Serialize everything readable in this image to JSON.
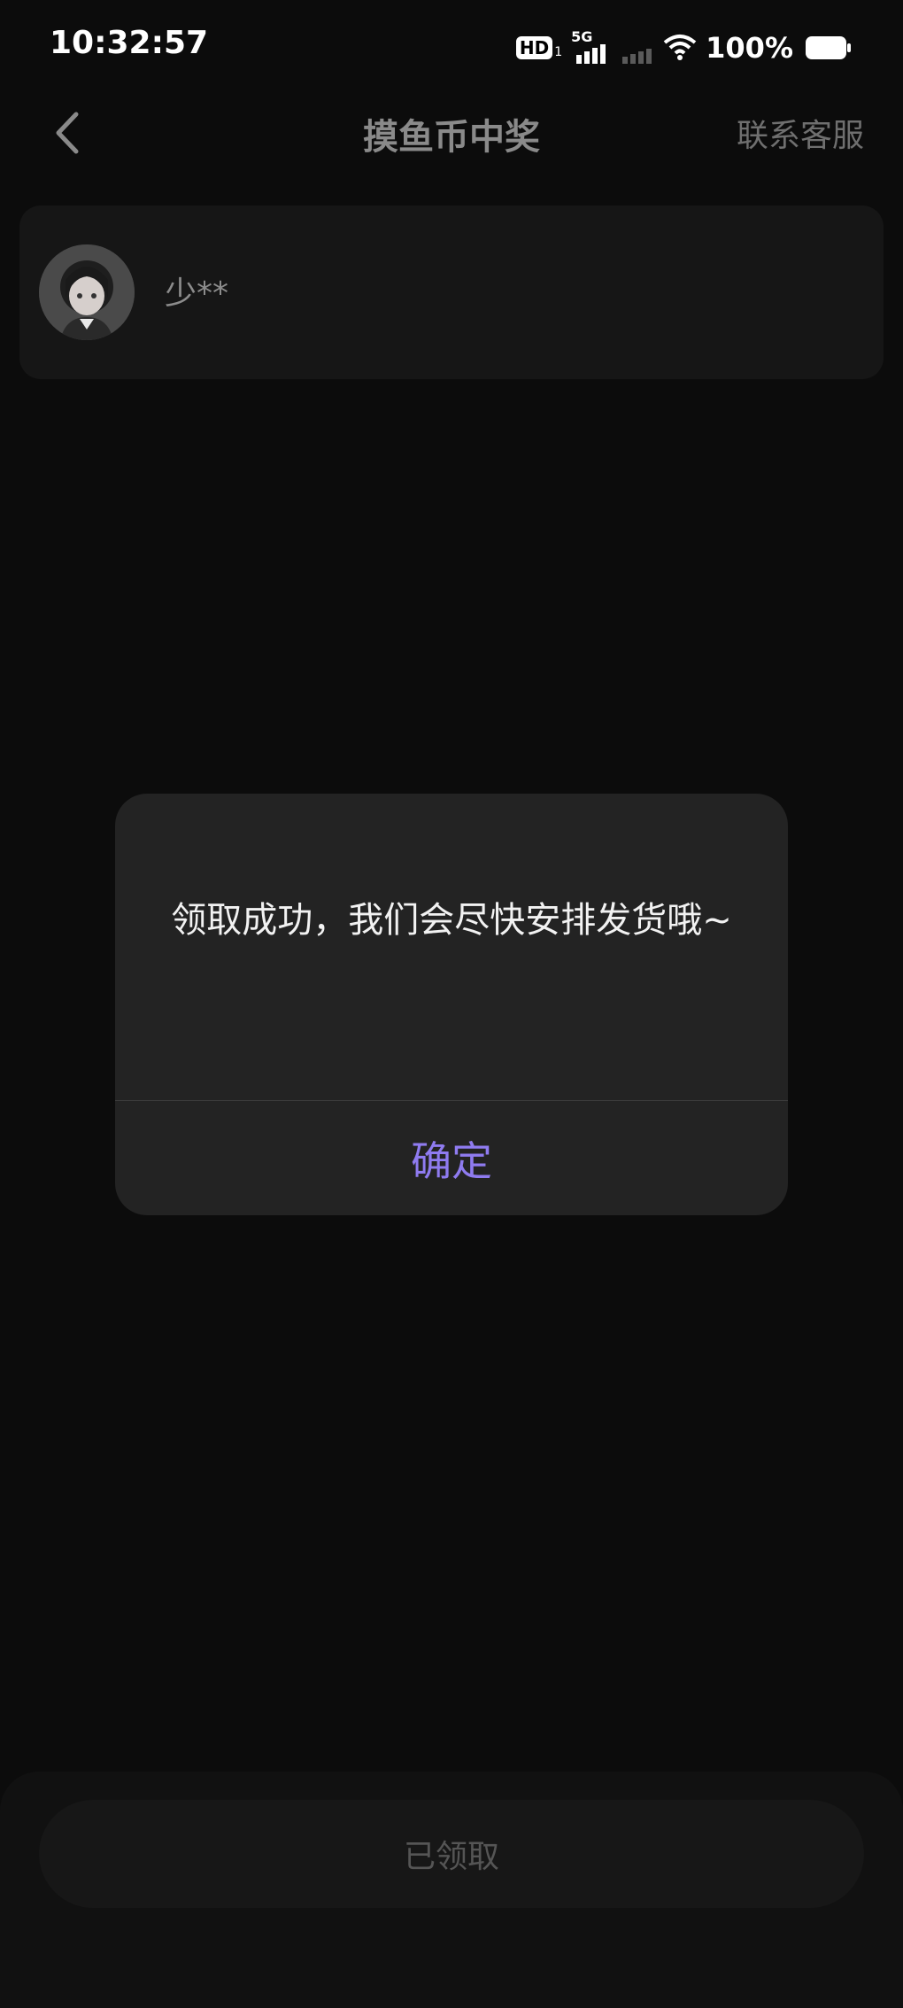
{
  "status_bar": {
    "time": "10:32:57",
    "network_badge": "HD",
    "network_badge_sub": "1",
    "network_type": "5G",
    "battery_percent": "100%",
    "icons": [
      "hd-icon",
      "signal-5g-icon",
      "signal-weak-icon",
      "wifi-icon",
      "battery-icon"
    ]
  },
  "nav": {
    "back_icon": "chevron-left-icon",
    "title": "摸鱼币中奖",
    "action": "联系客服"
  },
  "user_card": {
    "name": "少**"
  },
  "dialog": {
    "message": "领取成功，我们会尽快安排发货哦~",
    "confirm_label": "确定"
  },
  "bottom": {
    "button_label": "已领取"
  },
  "colors": {
    "background": "#0c0c0c",
    "dialog_bg": "#232323",
    "accent": "#8f7bf0"
  }
}
